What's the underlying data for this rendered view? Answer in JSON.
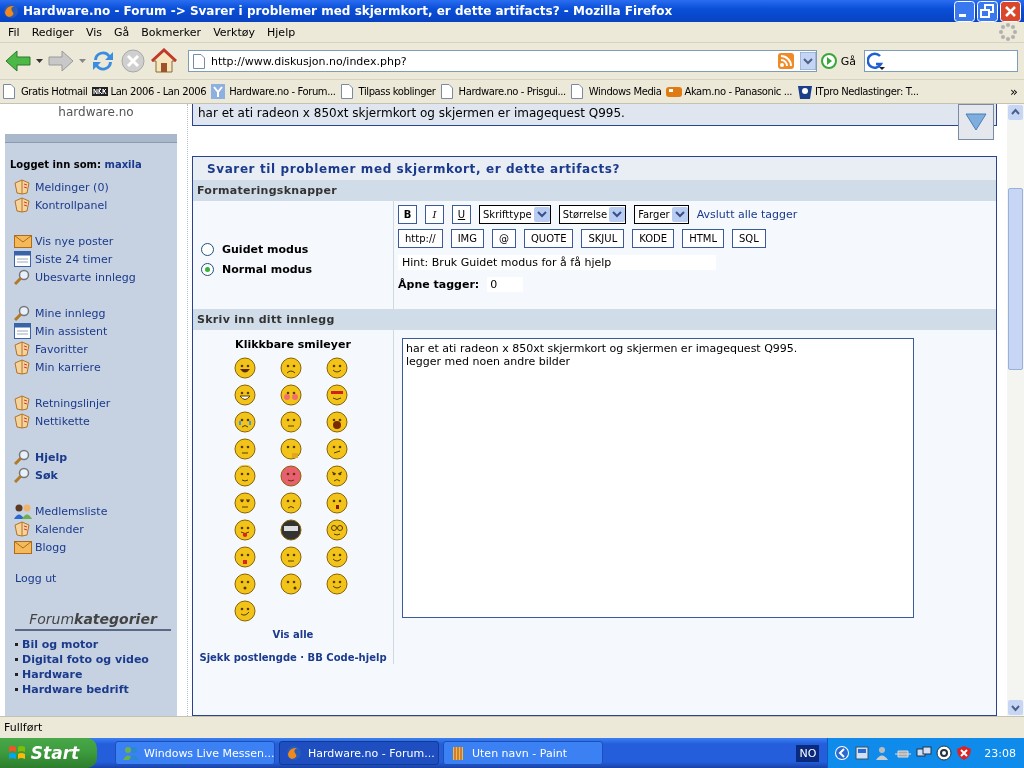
{
  "window": {
    "title": "Hardware.no - Forum -> Svarer i problemer med skjermkort, er dette artifacts? - Mozilla Firefox"
  },
  "menu": [
    "Fil",
    "Rediger",
    "Vis",
    "Gå",
    "Bokmerker",
    "Verktøy",
    "Hjelp"
  ],
  "toolbar": {
    "url": "http://www.diskusjon.no/index.php?",
    "go": "Gå"
  },
  "bookmarks": [
    {
      "label": "Gratis Hotmail",
      "kind": "page"
    },
    {
      "label": "Lan 2006 - Lan 2006",
      "kind": "nrk"
    },
    {
      "label": "Hardware.no - Forum...",
      "kind": "site"
    },
    {
      "label": "Tilpass koblinger",
      "kind": "page"
    },
    {
      "label": "Hardware.no - Prisgui...",
      "kind": "page"
    },
    {
      "label": "Windows Media",
      "kind": "page"
    },
    {
      "label": "Akam.no - Panasonic ...",
      "kind": "akam"
    },
    {
      "label": "ITpro Nedlastinger: T...",
      "kind": "itpro"
    }
  ],
  "bookmarks_more": "»",
  "sidebar": {
    "logo": "hardware.no",
    "login_label": "Logget inn som:",
    "user": "maxila",
    "groups": [
      [
        {
          "label": "Meldinger (0)",
          "kind": "book",
          "bold": false
        },
        {
          "label": "Kontrollpanel",
          "kind": "book",
          "bold": false
        }
      ],
      [
        {
          "label": "Vis nye poster",
          "kind": "mail",
          "bold": false
        },
        {
          "label": "Siste 24 timer",
          "kind": "calendar",
          "bold": false
        },
        {
          "label": "Ubesvarte innlegg",
          "kind": "magnifier",
          "bold": false
        }
      ],
      [
        {
          "label": "Mine innlegg",
          "kind": "magnifier",
          "bold": false
        },
        {
          "label": "Min assistent",
          "kind": "calendar",
          "bold": false
        },
        {
          "label": "Favoritter",
          "kind": "book",
          "bold": false
        },
        {
          "label": "Min karriere",
          "kind": "book",
          "bold": false
        }
      ],
      [
        {
          "label": "Retningslinjer",
          "kind": "book",
          "bold": false
        },
        {
          "label": "Nettikette",
          "kind": "book",
          "bold": false
        }
      ],
      [
        {
          "label": "Hjelp",
          "kind": "magnifier",
          "bold": true
        },
        {
          "label": "Søk",
          "kind": "magnifier",
          "bold": true
        }
      ],
      [
        {
          "label": "Medlemsliste",
          "kind": "people",
          "bold": false
        },
        {
          "label": "Kalender",
          "kind": "book",
          "bold": false
        },
        {
          "label": "Blogg",
          "kind": "mail",
          "bold": false
        }
      ]
    ],
    "logout": "Logg ut",
    "categories_title": "Forum**kategorier**",
    "categories": [
      "Bil og motor",
      "Digital foto og video",
      "Hardware",
      "Hardware bedrift"
    ]
  },
  "preview": {
    "text": "har et ati radeon x 850xt skjermkort og skjermen er imagequest Q995."
  },
  "reply": {
    "title": "Svarer til problemer med skjermkort, er dette artifacts?",
    "format_header": "Formateringsknapper",
    "modes": [
      {
        "label": "Guidet modus",
        "selected": false
      },
      {
        "label": "Normal modus",
        "selected": true
      }
    ],
    "style_buttons": [
      {
        "label": "B",
        "kind": "bold"
      },
      {
        "label": "I",
        "kind": "italic"
      },
      {
        "label": "U",
        "kind": "underline"
      }
    ],
    "dropdowns": [
      "Skrifttype",
      "Størrelse",
      "Farger"
    ],
    "close_tags": "Avslutt alle tagger",
    "tag_buttons": [
      "http://",
      "IMG",
      "@",
      "QUOTE",
      "SKJUL",
      "KODE",
      "HTML",
      "SQL"
    ],
    "hint": {
      "value": "Hint: Bruk Guidet modus for å få hjelp"
    },
    "open_tags_label": "Åpne tagger:",
    "open_tags": {
      "value": "0"
    },
    "post_header": "Skriv inn ditt innlegg",
    "smileys_title": "Klikkbare smileyer",
    "smileys": [
      {
        "kind": "grin"
      },
      {
        "kind": "sad"
      },
      {
        "kind": "smile"
      },
      {
        "kind": "laugh"
      },
      {
        "kind": "blush"
      },
      {
        "kind": "cool"
      },
      {
        "kind": "cry"
      },
      {
        "kind": "neutral"
      },
      {
        "kind": "shocked"
      },
      {
        "kind": "rolleyes"
      },
      {
        "kind": "thinking"
      },
      {
        "kind": "smirk"
      },
      {
        "kind": "angel"
      },
      {
        "kind": "inlove"
      },
      {
        "kind": "angry"
      },
      {
        "kind": "annoyed"
      },
      {
        "kind": "worried"
      },
      {
        "kind": "surprised"
      },
      {
        "kind": "tongue"
      },
      {
        "kind": "ninja"
      },
      {
        "kind": "nerd"
      },
      {
        "kind": "cheer"
      },
      {
        "kind": "thumbsdown"
      },
      {
        "kind": "thumbsup"
      },
      {
        "kind": "wave"
      },
      {
        "kind": "whistle"
      },
      {
        "kind": "happy"
      },
      {
        "kind": "wink"
      }
    ],
    "show_all": "Vis alle",
    "links": [
      "Sjekk postlengde",
      "BB Code-hjelp"
    ],
    "link_sep": "·",
    "message": {
      "value": "har et ati radeon x 850xt skjermkort og skjermen er imagequest Q995.\nlegger med noen andre bilder\n"
    }
  },
  "status_bar": "Fullført",
  "taskbar": {
    "start": "Start",
    "tasks": [
      {
        "label": "Windows Live Messen...",
        "kind": "messenger",
        "selected": false
      },
      {
        "label": "Hardware.no - Forum...",
        "kind": "firefox",
        "selected": true
      },
      {
        "label": "Uten navn - Paint",
        "kind": "paint",
        "selected": false
      }
    ],
    "language": "NO",
    "time": "23:08"
  }
}
